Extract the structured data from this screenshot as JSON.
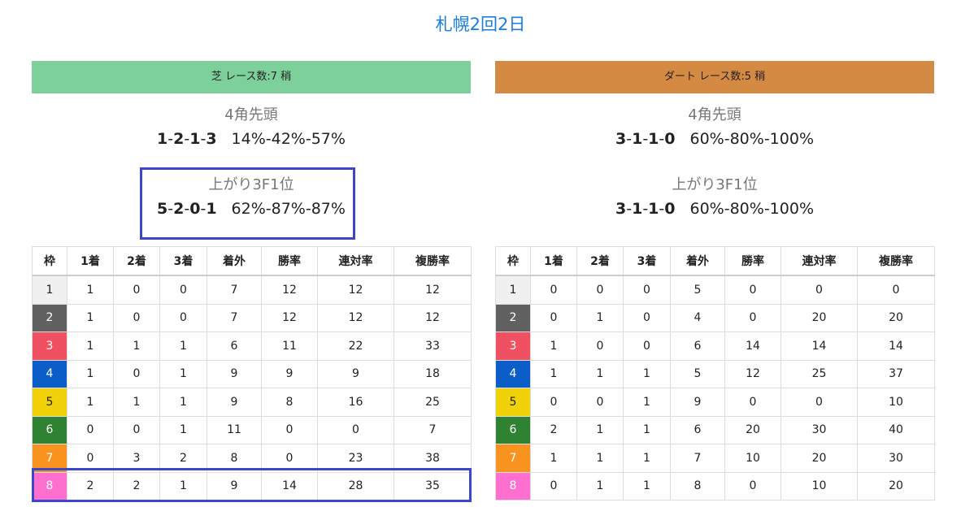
{
  "page_title": "札幌2回2日",
  "columns": [
    "枠",
    "1着",
    "2着",
    "3着",
    "着外",
    "勝率",
    "連対率",
    "複勝率"
  ],
  "waku_colors": {
    "1": {
      "bg": "#f0f0f0",
      "fg": "#222222"
    },
    "2": {
      "bg": "#616161",
      "fg": "#ffffff"
    },
    "3": {
      "bg": "#ef5062",
      "fg": "#ffffff"
    },
    "4": {
      "bg": "#0b5ec7",
      "fg": "#ffffff"
    },
    "5": {
      "bg": "#f1d20a",
      "fg": "#222222"
    },
    "6": {
      "bg": "#2e8232",
      "fg": "#ffffff"
    },
    "7": {
      "bg": "#f7931e",
      "fg": "#ffffff"
    },
    "8": {
      "bg": "#ff6fcf",
      "fg": "#ffffff"
    }
  },
  "turf": {
    "header": "芝 レース数:7 稍",
    "corner4": {
      "label": "4角先頭",
      "record": [
        "1",
        "2",
        "1",
        "3"
      ],
      "rates": "14%-42%-57%"
    },
    "last3f": {
      "label": "上がり3F1位",
      "record": [
        "5",
        "2",
        "0",
        "1"
      ],
      "rates": "62%-87%-87%"
    },
    "rows": [
      [
        "1",
        "1",
        "0",
        "0",
        "7",
        "12",
        "12",
        "12"
      ],
      [
        "2",
        "1",
        "0",
        "0",
        "7",
        "12",
        "12",
        "12"
      ],
      [
        "3",
        "1",
        "1",
        "1",
        "6",
        "11",
        "22",
        "33"
      ],
      [
        "4",
        "1",
        "0",
        "1",
        "9",
        "9",
        "9",
        "18"
      ],
      [
        "5",
        "1",
        "1",
        "1",
        "9",
        "8",
        "16",
        "25"
      ],
      [
        "6",
        "0",
        "0",
        "1",
        "11",
        "0",
        "0",
        "7"
      ],
      [
        "7",
        "0",
        "3",
        "2",
        "8",
        "0",
        "23",
        "38"
      ],
      [
        "8",
        "2",
        "2",
        "1",
        "9",
        "14",
        "28",
        "35"
      ]
    ]
  },
  "dirt": {
    "header": "ダート レース数:5 稍",
    "corner4": {
      "label": "4角先頭",
      "record": [
        "3",
        "1",
        "1",
        "0"
      ],
      "rates": "60%-80%-100%"
    },
    "last3f": {
      "label": "上がり3F1位",
      "record": [
        "3",
        "1",
        "1",
        "0"
      ],
      "rates": "60%-80%-100%"
    },
    "rows": [
      [
        "1",
        "0",
        "0",
        "0",
        "5",
        "0",
        "0",
        "0"
      ],
      [
        "2",
        "0",
        "1",
        "0",
        "4",
        "0",
        "20",
        "20"
      ],
      [
        "3",
        "1",
        "0",
        "0",
        "6",
        "14",
        "14",
        "14"
      ],
      [
        "4",
        "1",
        "1",
        "1",
        "5",
        "12",
        "25",
        "37"
      ],
      [
        "5",
        "0",
        "0",
        "1",
        "9",
        "0",
        "0",
        "10"
      ],
      [
        "6",
        "2",
        "1",
        "1",
        "6",
        "20",
        "30",
        "40"
      ],
      [
        "7",
        "1",
        "1",
        "1",
        "7",
        "10",
        "20",
        "30"
      ],
      [
        "8",
        "0",
        "1",
        "1",
        "8",
        "0",
        "10",
        "20"
      ]
    ]
  }
}
